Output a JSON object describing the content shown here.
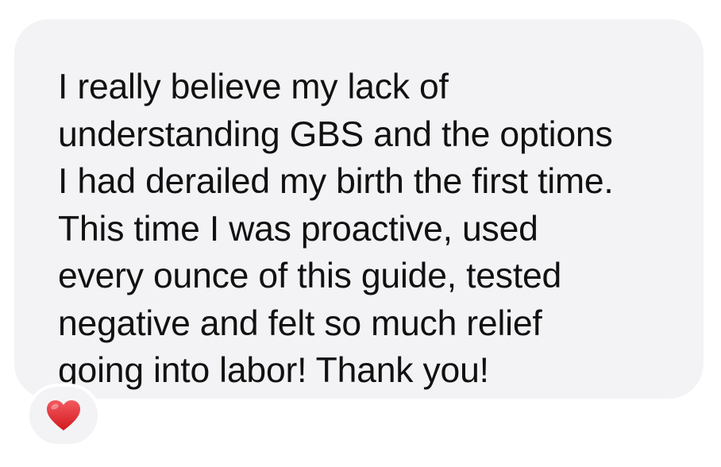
{
  "message": {
    "lines": [
      "I really believe my lack of",
      "understanding GBS and the options",
      "I had derailed my birth the first time.",
      "This time I was proactive, used",
      "every ounce of this guide, tested",
      "negative and felt so much relief",
      "going into labor! Thank you!"
    ]
  },
  "reaction": {
    "icon": "heart-icon",
    "color": "#e0242c"
  },
  "colors": {
    "bubble": "#f3f3f5",
    "text": "#111111",
    "background": "#ffffff"
  }
}
